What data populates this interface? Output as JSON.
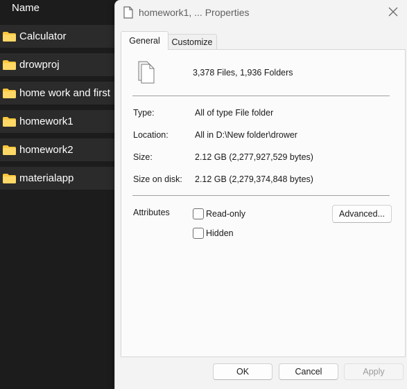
{
  "explorer": {
    "column_header": "Name",
    "folders": [
      {
        "name": "Calculator",
        "icon": "folder-icon"
      },
      {
        "name": "drowproj",
        "icon": "folder-icon"
      },
      {
        "name": "home work and first",
        "icon": "folder-icon"
      },
      {
        "name": "homework1",
        "icon": "folder-icon"
      },
      {
        "name": "homework2",
        "icon": "folder-icon"
      },
      {
        "name": "materialapp",
        "icon": "folder-icon"
      }
    ],
    "folder_color": "#ffc83d"
  },
  "dialog": {
    "title": "homework1, ... Properties",
    "title_icon": "document-icon",
    "close_icon": "close-icon",
    "tabs": [
      {
        "label": "General",
        "active": true
      },
      {
        "label": "Customize",
        "active": false
      }
    ],
    "summary_icon": "multiple-files-icon",
    "files_count": "3,378 Files, 1,936 Folders",
    "properties": {
      "type_label": "Type:",
      "type_value": "All of type File folder",
      "location_label": "Location:",
      "location_value": "All in D:\\New folder\\drower",
      "size_label": "Size:",
      "size_value": "2.12 GB (2,277,927,529 bytes)",
      "size_on_disk_label": "Size on disk:",
      "size_on_disk_value": "2.12 GB (2,279,374,848 bytes)"
    },
    "attributes": {
      "label": "Attributes",
      "readonly_label": "Read-only",
      "readonly_checked": false,
      "hidden_label": "Hidden",
      "hidden_checked": false,
      "advanced_button": "Advanced..."
    },
    "buttons": {
      "ok": "OK",
      "cancel": "Cancel",
      "apply": "Apply"
    }
  }
}
